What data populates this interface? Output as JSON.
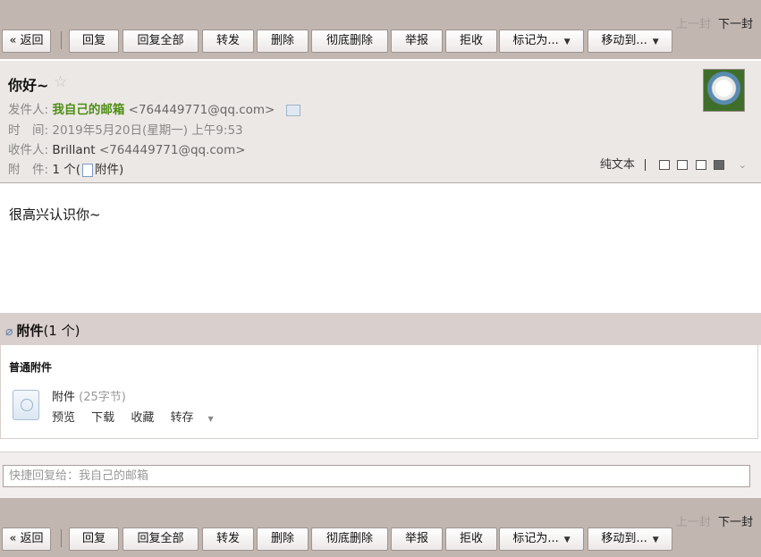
{
  "toolbar": {
    "prev": "上一封",
    "next": "下一封",
    "back": "« 返回",
    "reply": "回复",
    "reply_all": "回复全部",
    "forward": "转发",
    "delete": "删除",
    "delete_permanently": "彻底删除",
    "report": "举报",
    "reject": "拒收",
    "mark_as": "标记为...",
    "move_to": "移动到..."
  },
  "mail": {
    "subject": "你好~",
    "star_icon": "☆",
    "from_label": "发件人:",
    "from_name": "我自己的邮箱",
    "from_addr": "<764449771@qq.com>",
    "time_label": "时　间:",
    "time_value": "2019年5月20日(星期一) 上午9:53",
    "to_label": "收件人:",
    "to_name": "Brillant",
    "to_addr": "<764449771@qq.com>",
    "attach_label": "附　件:",
    "attach_count": "1 个",
    "attach_link": "附件",
    "plain_text": "纯文本",
    "body": "很高兴认识你~"
  },
  "attachments": {
    "title": "附件",
    "count": "(1 个)",
    "kind": "普通附件",
    "file_name": "附件",
    "file_size": "(25字节)",
    "preview": "预览",
    "download": "下载",
    "collect": "收藏",
    "save_to": "转存"
  },
  "quick_reply": {
    "placeholder": "快捷回复给：我自己的邮箱"
  }
}
